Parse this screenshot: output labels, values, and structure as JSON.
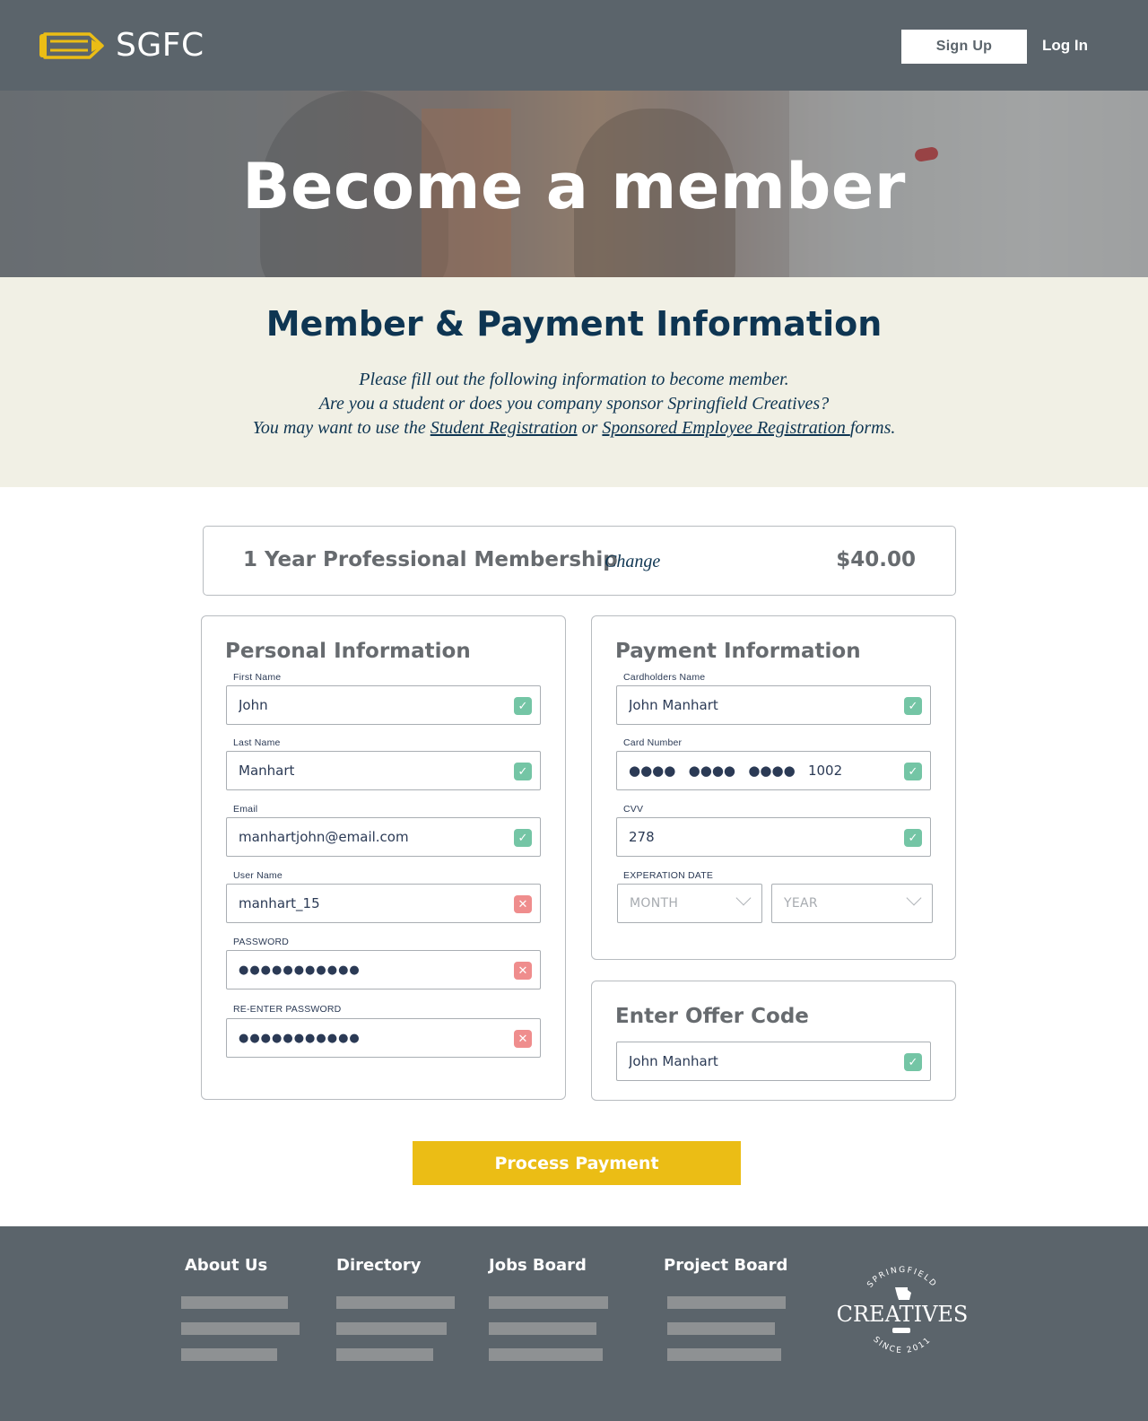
{
  "brand": {
    "name": "SGFC",
    "accent": "#ebbd15",
    "header_bg": "#5b646b",
    "navy": "#0e3552"
  },
  "header": {
    "signup_label": "Sign Up",
    "login_label": "Log In"
  },
  "hero": {
    "title": "Become a member"
  },
  "intro": {
    "title": "Member & Payment Information",
    "line1": "Please fill out the following information to become member.",
    "line2": "Are you a student or does you company sponsor Springfield Creatives?",
    "line3_prefix": "You may want to use the ",
    "student_link": "Student Registration",
    "line3_mid": " or ",
    "sponsored_link": "Sponsored Employee Registration ",
    "line3_suffix": "forms."
  },
  "membership": {
    "name": "1 Year Professional Membership",
    "change_label": "Change",
    "price": "$40.00"
  },
  "personal": {
    "title": "Personal Information",
    "fields": [
      {
        "label": "First Name",
        "value": "John",
        "status": "valid"
      },
      {
        "label": "Last Name",
        "value": "Manhart",
        "status": "valid"
      },
      {
        "label": "Email",
        "value": "manhartjohn@email.com",
        "status": "valid"
      },
      {
        "label": "User Name",
        "value": "manhart_15",
        "status": "invalid"
      },
      {
        "label": "PASSWORD",
        "value": "●●●●●●●●●●●",
        "status": "invalid"
      },
      {
        "label": "RE-ENTER PASSWORD",
        "value": "●●●●●●●●●●●",
        "status": "invalid"
      }
    ]
  },
  "payment": {
    "title": "Payment Information",
    "fields": [
      {
        "label": "Cardholders Name",
        "value": "John Manhart",
        "status": "valid"
      },
      {
        "label": "Card Number",
        "value": "●●●●   ●●●●   ●●●●   1002",
        "status": "valid"
      },
      {
        "label": "CVV",
        "value": "278",
        "status": "valid"
      }
    ],
    "expiration_label": "EXPERATION DATE",
    "month_placeholder": "MONTH",
    "year_placeholder": "YEAR"
  },
  "offer": {
    "title": "Enter Offer Code",
    "value": "John Manhart",
    "status": "valid"
  },
  "status_icons": {
    "valid": "check-icon",
    "invalid": "x-icon",
    "valid_color": "#74c5a5",
    "invalid_color": "#ef8d8d"
  },
  "process_label": "Process Payment",
  "footer": {
    "columns": [
      "About Us",
      "Directory",
      "Jobs Board",
      "Project Board"
    ],
    "badge": {
      "top_arc": "SPRINGFIELD",
      "name": "CREATIVES",
      "bottom_arc": "SINCE 2011"
    }
  }
}
